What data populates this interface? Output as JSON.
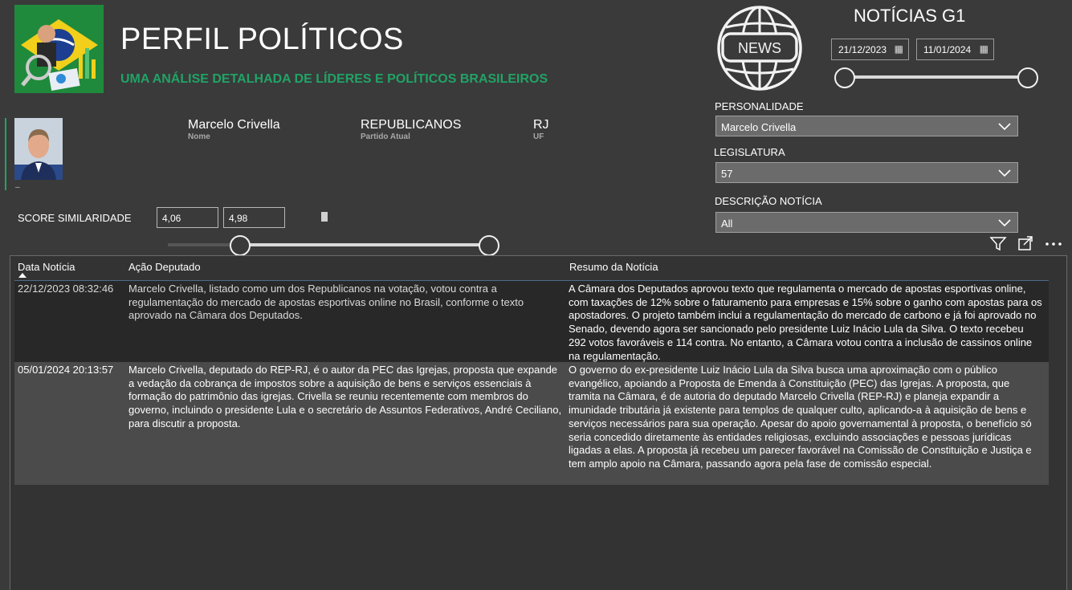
{
  "header": {
    "title": "PERFIL POLÍTICOS",
    "subtitle": "UMA ANÁLISE DETALHADA DE LÍDERES E POLÍTICOS BRASILEIROS",
    "news_icon_label": "NEWS",
    "news_heading": "NOTÍCIAS G1"
  },
  "date_range": {
    "start": "21/12/2023",
    "end": "11/01/2024"
  },
  "filters": {
    "personalidade": {
      "label": "PERSONALIDADE",
      "value": "Marcelo Crivella"
    },
    "legislatura": {
      "label": "LEGISLATURA",
      "value": "57"
    },
    "descricao": {
      "label": "DESCRIÇÃO NOTÍCIA",
      "value": "All"
    }
  },
  "profile": {
    "dash": "–",
    "name_value": "Marcelo Crivella",
    "name_label": "Nome",
    "party_value": "REPUBLICANOS",
    "party_label": "Partido Atual",
    "uf_value": "RJ",
    "uf_label": "UF"
  },
  "score": {
    "label": "SCORE SIMILARIDADE",
    "min": "4,06",
    "max": "4,98"
  },
  "table": {
    "headers": [
      "Data Notícia",
      "Ação Deputado",
      "Resumo da Notícia"
    ],
    "rows": [
      {
        "date": "22/12/2023 08:32:46",
        "acao": "Marcelo Crivella, listado como um dos Republicanos na votação, votou contra a regulamentação do mercado de apostas esportivas online no Brasil, conforme o texto aprovado na Câmara dos Deputados.",
        "resumo": "A Câmara dos Deputados aprovou texto que regulamenta o mercado de apostas esportivas online, com taxações de 12% sobre o faturamento para empresas e 15% sobre o ganho com apostas para os apostadores. O projeto também inclui a regulamentação do mercado de carbono e já foi aprovado no Senado, devendo agora ser sancionado pelo presidente Luiz Inácio Lula da Silva. O texto recebeu 292 votos favoráveis e 114 contra. No entanto, a Câmara votou contra a inclusão de cassinos online na regulamentação."
      },
      {
        "date": "05/01/2024 20:13:57",
        "acao": "Marcelo Crivella, deputado do REP-RJ, é o autor da PEC das Igrejas, proposta que expande a vedação da cobrança de impostos sobre a aquisição de bens e serviços essenciais à formação do patrimônio das igrejas. Crivella se reuniu recentemente com membros do governo, incluindo o presidente Lula e o secretário de Assuntos Federativos, André Ceciliano, para discutir a proposta.",
        "resumo": "O governo do ex-presidente Luiz Inácio Lula da Silva busca uma aproximação com o público evangélico, apoiando a Proposta de Emenda à Constituição (PEC) das Igrejas. A proposta, que tramita na Câmara, é de autoria do deputado Marcelo Crivella (REP-RJ) e planeja expandir a imunidade tributária já existente para templos de qualquer culto, aplicando-a à aquisição de bens e serviços necessários para sua operação. Apesar do apoio governamental à proposta, o benefício só seria concedido diretamente às entidades religiosas, excluindo associações e pessoas jurídicas ligadas a elas. A proposta já recebeu um parecer favorável na Comissão de Constituição e Justiça e tem amplo apoio na Câmara, passando agora pela fase de comissão especial."
      }
    ]
  },
  "colors": {
    "background": "#3a3a3a",
    "subtitle_green": "#21a366",
    "row_dark": "#282828",
    "row_light": "#4b4b4b",
    "dropdown_bg": "#6b6b6b"
  },
  "icons": {
    "logo": "brazil-flag-analytics-logo",
    "news": "globe-news-icon",
    "calendar": "calendar-icon",
    "chevron": "chevron-down-icon",
    "filter": "filter-icon",
    "focus": "focus-mode-icon",
    "more": "more-options-icon"
  }
}
